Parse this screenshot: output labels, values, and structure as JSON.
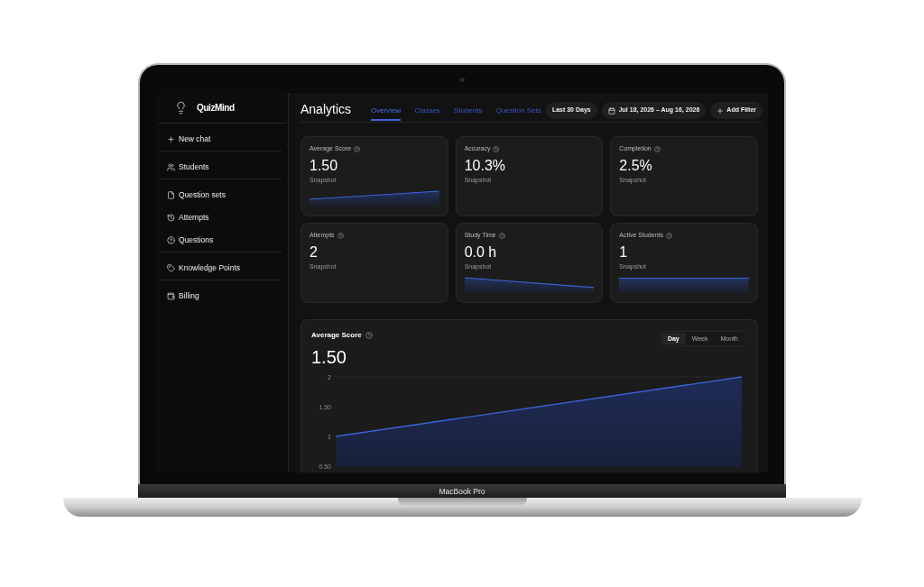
{
  "sidebar": {
    "logo": "QuizMind",
    "groups": [
      {
        "items": [
          {
            "label": "New chat"
          }
        ]
      },
      {
        "items": [
          {
            "label": "Students"
          }
        ]
      },
      {
        "items": [
          {
            "label": "Question sets"
          },
          {
            "label": "Attempts"
          },
          {
            "label": "Questions"
          }
        ]
      },
      {
        "items": [
          {
            "label": "Knowledge Points"
          }
        ]
      },
      {
        "items": [
          {
            "label": "Billing"
          }
        ]
      }
    ]
  },
  "header": {
    "title": "Analytics",
    "tabs": [
      {
        "label": "Overview",
        "selected": true
      },
      {
        "label": "Classes",
        "selected": false
      },
      {
        "label": "Students",
        "selected": false
      },
      {
        "label": "Question Sets",
        "selected": false
      }
    ],
    "range_button": "Last 30 Days",
    "date_range": "Jul 18, 2026 – Aug 16, 2026",
    "filter_button": "Add Filter"
  },
  "cards": [
    {
      "kind": "rising",
      "title": "Average Score",
      "value": "1.50",
      "caption": "Snapshot"
    },
    {
      "kind": "plain",
      "title": "Accuracy",
      "value": "10.3%",
      "caption": "Snapshot"
    },
    {
      "kind": "plain",
      "title": "Completion",
      "value": "2.5%",
      "caption": "Snapshot"
    },
    {
      "kind": "plain",
      "title": "Attempts",
      "value": "2",
      "caption": "Snapshot"
    },
    {
      "kind": "falling",
      "title": "Study Time",
      "value": "0.0 h",
      "caption": "Snapshot"
    },
    {
      "kind": "flat",
      "title": "Active Students",
      "value": "1",
      "caption": "Snapshot"
    }
  ],
  "chart_card": {
    "value": "1.50",
    "periods": [
      {
        "label": "Day",
        "selected": true
      },
      {
        "label": "Week",
        "selected": false
      },
      {
        "label": "Month",
        "selected": false
      }
    ],
    "chart_data": {
      "type": "area",
      "title": "Average Score",
      "categories": [
        null,
        null
      ],
      "ylim": [
        0.5,
        2
      ],
      "yticks": [
        {
          "value": 2,
          "label": "2"
        },
        {
          "value": 1.5,
          "label": "1.50"
        },
        {
          "value": 1,
          "label": "1"
        },
        {
          "value": 0.5,
          "label": "0.50"
        }
      ],
      "series": [
        {
          "color": "#3b63d8",
          "values": [
            1,
            2
          ]
        }
      ]
    }
  },
  "device": {
    "label": "MacBook Pro"
  }
}
